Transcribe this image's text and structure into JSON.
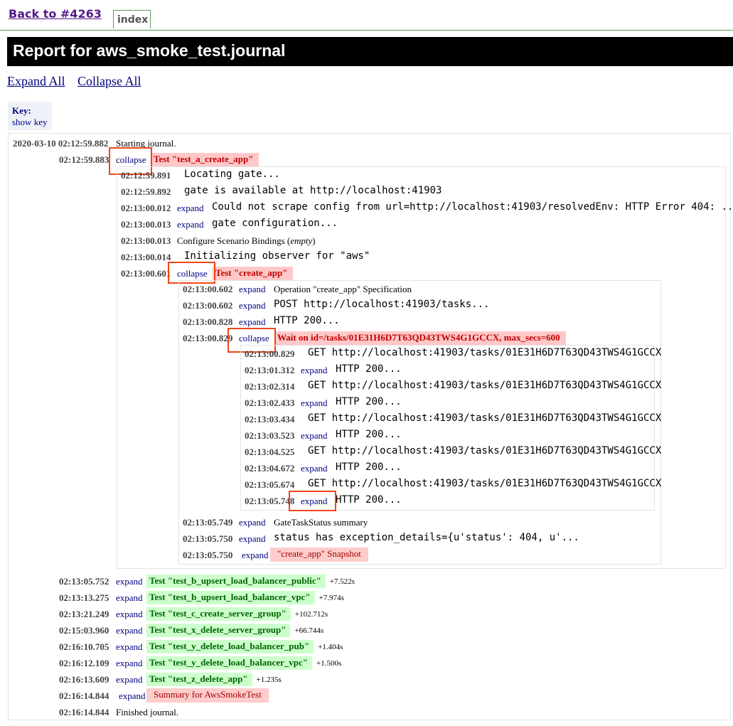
{
  "header": {
    "back_link": "Back to #4263",
    "index_tab": "index",
    "title": "Report for aws_smoke_test.journal"
  },
  "controls": {
    "expand_all": "Expand All",
    "collapse_all": "Collapse All"
  },
  "key": {
    "title": "Key:",
    "show": "show key"
  },
  "labels": {
    "expand": "expand",
    "collapse": "collapse"
  },
  "journal": {
    "start_ts": "2020-03-10 02:12:59.882",
    "start_text": "Starting journal.",
    "test_a": {
      "ts": "02:12:59.883",
      "title": "Test \"test_a_create_app\"",
      "entries": [
        {
          "ts": "02:12:59.891",
          "text": "Locating gate..."
        },
        {
          "ts": "02:12:59.892",
          "text": "gate is available at http://localhost:41903"
        },
        {
          "ts": "02:13:00.012",
          "text": "Could not scrape config from url=http://localhost:41903/resolvedEnv: HTTP Error 404: ..."
        },
        {
          "ts": "02:13:00.013",
          "text": "gate configuration..."
        },
        {
          "ts": "02:13:00.013",
          "text": "Configure Scenario Bindings (",
          "em": "empty",
          "tail": ")"
        },
        {
          "ts": "02:13:00.014",
          "text": "Initializing observer for \"aws\""
        }
      ],
      "create_app": {
        "ts": "02:13:00.601",
        "title": "Test \"create_app\"",
        "entries": [
          {
            "ts": "02:13:00.602",
            "text": "Operation \"create_app\" Specification"
          },
          {
            "ts": "02:13:00.602",
            "text": "POST http://localhost:41903/tasks..."
          },
          {
            "ts": "02:13:00.828",
            "text": "HTTP 200..."
          }
        ],
        "wait": {
          "ts": "02:13:00.829",
          "title": "Wait on id=/tasks/01E31H6D7T63QD43TWS4G1GCCX, max_secs=600",
          "entries": [
            {
              "ts": "02:13:00.829",
              "text": "GET http://localhost:41903/tasks/01E31H6D7T63QD43TWS4G1GCCX"
            },
            {
              "ts": "02:13:01.312",
              "text": "HTTP 200..."
            },
            {
              "ts": "02:13:02.314",
              "text": "GET http://localhost:41903/tasks/01E31H6D7T63QD43TWS4G1GCCX"
            },
            {
              "ts": "02:13:02.433",
              "text": "HTTP 200..."
            },
            {
              "ts": "02:13:03.434",
              "text": "GET http://localhost:41903/tasks/01E31H6D7T63QD43TWS4G1GCCX"
            },
            {
              "ts": "02:13:03.523",
              "text": "HTTP 200..."
            },
            {
              "ts": "02:13:04.525",
              "text": "GET http://localhost:41903/tasks/01E31H6D7T63QD43TWS4G1GCCX"
            },
            {
              "ts": "02:13:04.672",
              "text": "HTTP 200..."
            },
            {
              "ts": "02:13:05.674",
              "text": "GET http://localhost:41903/tasks/01E31H6D7T63QD43TWS4G1GCCX"
            },
            {
              "ts": "02:13:05.748",
              "text": "HTTP 200..."
            }
          ]
        },
        "after": [
          {
            "ts": "02:13:05.749",
            "text": "GateTaskStatus summary"
          },
          {
            "ts": "02:13:05.750",
            "text": "status has exception_details={u'status': 404, u'..."
          },
          {
            "ts": "02:13:05.750",
            "text": "\"create_app\" Snapshot"
          }
        ]
      }
    },
    "tests": [
      {
        "ts": "02:13:05.752",
        "title": "Test \"test_b_upsert_load_balancer_public\"",
        "dur": "+7.522s"
      },
      {
        "ts": "02:13:13.275",
        "title": "Test \"test_b_upsert_load_balancer_vpc\"",
        "dur": "+7.974s"
      },
      {
        "ts": "02:13:21.249",
        "title": "Test \"test_c_create_server_group\"",
        "dur": "+102.712s"
      },
      {
        "ts": "02:15:03.960",
        "title": "Test \"test_x_delete_server_group\"",
        "dur": "+66.744s"
      },
      {
        "ts": "02:16:10.705",
        "title": "Test \"test_y_delete_load_balancer_pub\"",
        "dur": "+1.404s"
      },
      {
        "ts": "02:16:12.109",
        "title": "Test \"test_y_delete_load_balancer_vpc\"",
        "dur": "+1.500s"
      },
      {
        "ts": "02:16:13.609",
        "title": "Test \"test_z_delete_app\"",
        "dur": "+1.235s"
      }
    ],
    "summary": {
      "ts": "02:16:14.844",
      "title": "Summary for AwsSmokeTest"
    },
    "finish": {
      "ts": "02:16:14.844",
      "text": "Finished journal."
    }
  }
}
